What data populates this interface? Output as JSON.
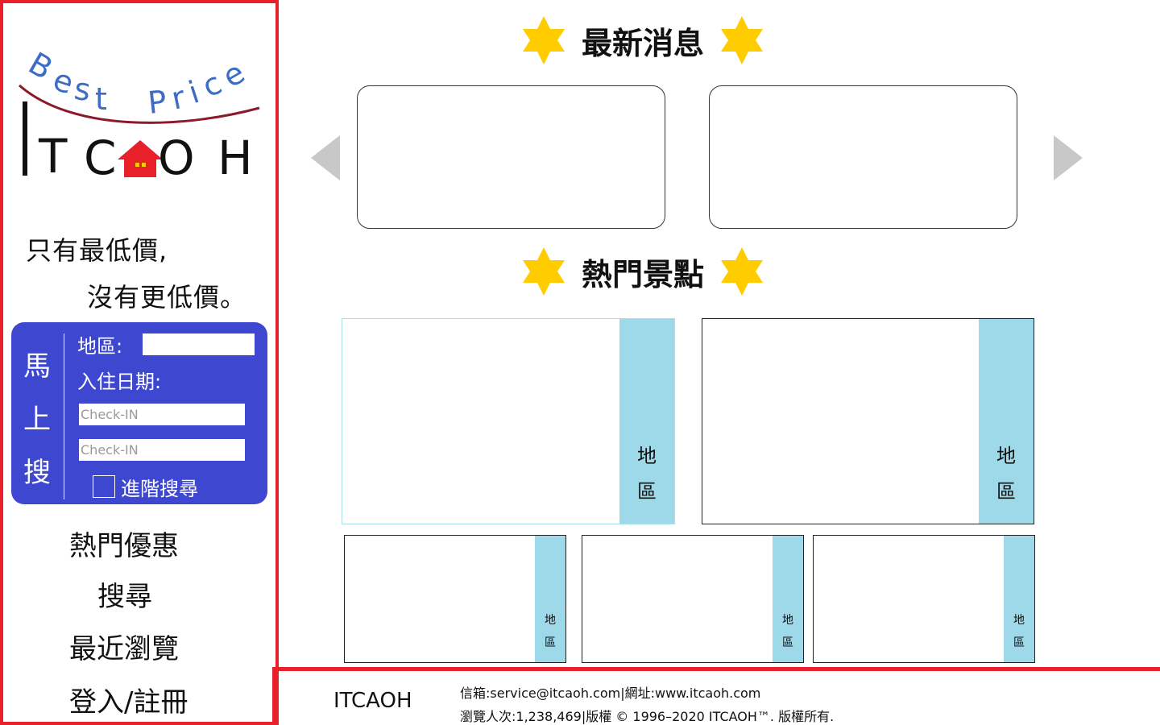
{
  "brand": {
    "logo_tagline": "Best Price",
    "logo_wordmark": "ITCAOH",
    "slogan_line1": "只有最低價,",
    "slogan_line2": "沒有更低價。"
  },
  "quick_search": {
    "title_chars": [
      "馬",
      "上",
      "搜"
    ],
    "region_label": "地區:",
    "region_value": "",
    "date_label": "入住日期:",
    "checkin_placeholder_1": "Check-IN",
    "checkin_placeholder_2": "Check-IN",
    "advanced_label": "進階搜尋",
    "advanced_checked": false
  },
  "nav": {
    "hot_deals": "熱門優惠",
    "search": "搜尋",
    "recent": "最近瀏覽",
    "login": "登入/註冊"
  },
  "news": {
    "heading": "最新消息",
    "prev_icon": "triangle-left-icon",
    "next_icon": "triangle-right-icon"
  },
  "spots": {
    "heading": "熱門景點",
    "cards": [
      {
        "region": "地區"
      },
      {
        "region": "地區"
      },
      {
        "region": "地區"
      },
      {
        "region": "地區"
      },
      {
        "region": "地區"
      }
    ]
  },
  "footer": {
    "brand": "ITCAOH",
    "contact": "信箱:service@itcaoh.com|網址:www.itcaoh.com",
    "stats": "瀏覽人次:1,238,469|版權 © 1996–2020 ITCAOH™. 版權所有."
  },
  "colors": {
    "frame_red": "#e8202a",
    "search_panel_blue": "#3d47cf",
    "tag_light_blue": "#9ed9ea",
    "star_yellow": "#ffcc00",
    "arrow_gray": "#c8c8c8",
    "logo_blue": "#3c6cc4",
    "logo_roof_red": "#e8202a",
    "logo_swoosh": "#8b1a2a"
  }
}
